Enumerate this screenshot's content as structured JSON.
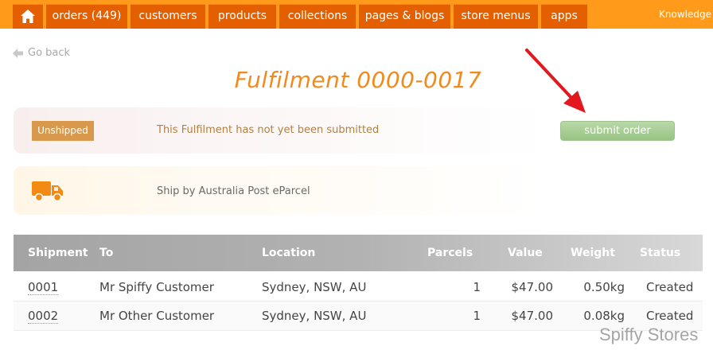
{
  "nav": {
    "home_icon": "home-icon",
    "tabs": [
      {
        "label": "orders (449)"
      },
      {
        "label": "customers"
      },
      {
        "label": "products"
      },
      {
        "label": "collections"
      },
      {
        "label": "pages & blogs"
      },
      {
        "label": "store menus"
      },
      {
        "label": "apps"
      }
    ],
    "knowledge_label": "Knowledge b"
  },
  "go_back_label": "Go back",
  "page_title": "Fulfilment 0000-0017",
  "status": {
    "badge": "Unshipped",
    "message": "This Fulfilment has not yet been submitted",
    "submit_label": "submit order"
  },
  "shipping": {
    "icon": "truck-icon",
    "message": "Ship by Australia Post eParcel"
  },
  "table": {
    "headers": [
      "Shipment",
      "To",
      "Location",
      "Parcels",
      "Value",
      "Weight",
      "Status"
    ],
    "rows": [
      {
        "shipment": "0001",
        "to": "Mr Spiffy Customer",
        "location": "Sydney, NSW, AU",
        "parcels": "1",
        "value": "$47.00",
        "weight": "0.50kg",
        "status": "Created"
      },
      {
        "shipment": "0002",
        "to": "Mr Other Customer",
        "location": "Sydney, NSW, AU",
        "parcels": "1",
        "value": "$47.00",
        "weight": "0.08kg",
        "status": "Created"
      }
    ]
  },
  "watermark": "Spiffy Stores",
  "colors": {
    "nav_bg": "#ff9a1a",
    "tab_bg": "#e35f00",
    "title": "#f08a1c",
    "badge": "#d8994c",
    "submit": "#97c483",
    "arrow": "#e3171e"
  }
}
